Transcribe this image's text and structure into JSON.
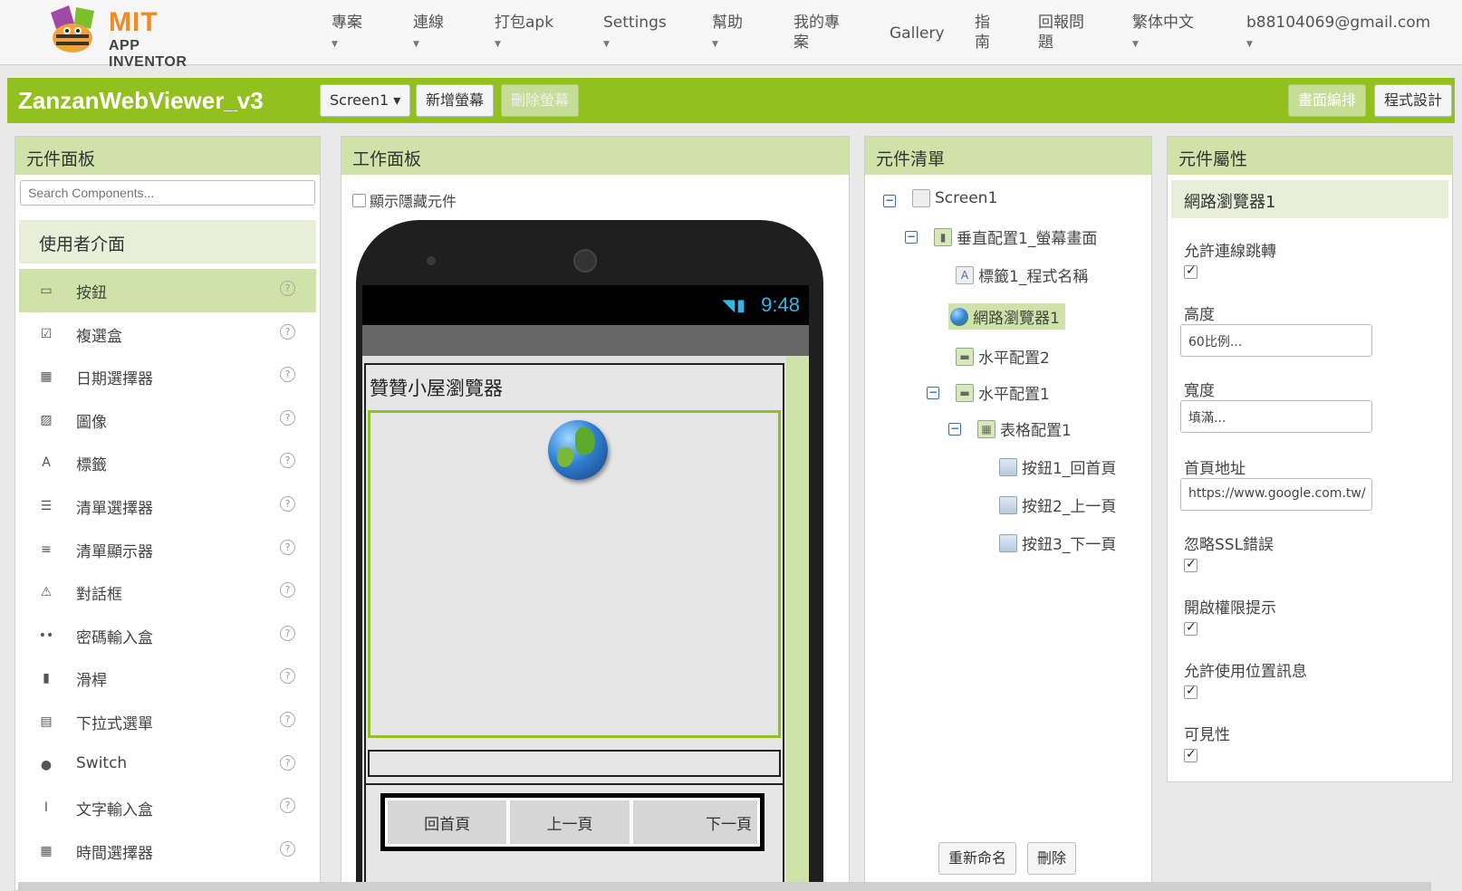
{
  "nav": {
    "logo_mit": "MIT",
    "logo_ai": "APP INVENTOR",
    "items": [
      "專案",
      "連線",
      "打包apk",
      "Settings",
      "幫助",
      "我的專案",
      "Gallery",
      "指南",
      "回報問題",
      "繁体中文",
      "b88104069@gmail.com"
    ]
  },
  "project": {
    "title": "ZanzanWebViewer_v3",
    "screen_select": "Screen1 ▾",
    "add_screen": "新增螢幕",
    "remove_screen": "刪除螢幕",
    "designer": "畫面編排",
    "blocks": "程式設計"
  },
  "palette": {
    "header": "元件面板",
    "search_placeholder": "Search Components...",
    "category": "使用者介面",
    "help": "?",
    "items": [
      {
        "label": "按鈕",
        "icon": "button-icon",
        "glyph": "▭"
      },
      {
        "label": "複選盒",
        "icon": "checkbox-icon",
        "glyph": "☑"
      },
      {
        "label": "日期選擇器",
        "icon": "datepicker-icon",
        "glyph": "▦"
      },
      {
        "label": "圖像",
        "icon": "image-icon",
        "glyph": "▨"
      },
      {
        "label": "標籤",
        "icon": "label-icon",
        "glyph": "A"
      },
      {
        "label": "清單選擇器",
        "icon": "listpicker-icon",
        "glyph": "☰"
      },
      {
        "label": "清單顯示器",
        "icon": "listview-icon",
        "glyph": "≡"
      },
      {
        "label": "對話框",
        "icon": "notifier-icon",
        "glyph": "⚠"
      },
      {
        "label": "密碼輸入盒",
        "icon": "password-icon",
        "glyph": "••"
      },
      {
        "label": "滑桿",
        "icon": "slider-icon",
        "glyph": "▮"
      },
      {
        "label": "下拉式選單",
        "icon": "spinner-icon",
        "glyph": "▤"
      },
      {
        "label": "Switch",
        "icon": "switch-icon",
        "glyph": "●"
      },
      {
        "label": "文字輸入盒",
        "icon": "textbox-icon",
        "glyph": "I"
      },
      {
        "label": "時間選擇器",
        "icon": "timepicker-icon",
        "glyph": "▦"
      }
    ]
  },
  "viewer": {
    "header": "工作面板",
    "show_hidden": "顯示隱藏元件",
    "time": "9:48",
    "app_label": "贊贊小屋瀏覽器",
    "buttons": [
      "回首頁",
      "上一頁",
      "下一頁"
    ]
  },
  "tree": {
    "header": "元件清單",
    "collapse": "−",
    "nodes": [
      "Screen1",
      "垂直配置1_螢幕畫面",
      "標籤1_程式名稱",
      "網路瀏覽器1",
      "水平配置2",
      "水平配置1",
      "表格配置1",
      "按鈕1_回首頁",
      "按鈕2_上一頁",
      "按鈕3_下一頁"
    ],
    "rename": "重新命名",
    "delete": "刪除"
  },
  "props": {
    "header": "元件屬性",
    "component": "網路瀏覽器1",
    "follow_links": "允許連線跳轉",
    "height": "高度",
    "height_value": "60比例...",
    "width": "寬度",
    "width_value": "填滿...",
    "home_url": "首頁地址",
    "home_url_value": "https://www.google.com.tw/",
    "ignore_ssl": "忽略SSL錯誤",
    "prompt_permission": "開啟權限提示",
    "use_location": "允許使用位置訊息",
    "visible": "可見性"
  }
}
